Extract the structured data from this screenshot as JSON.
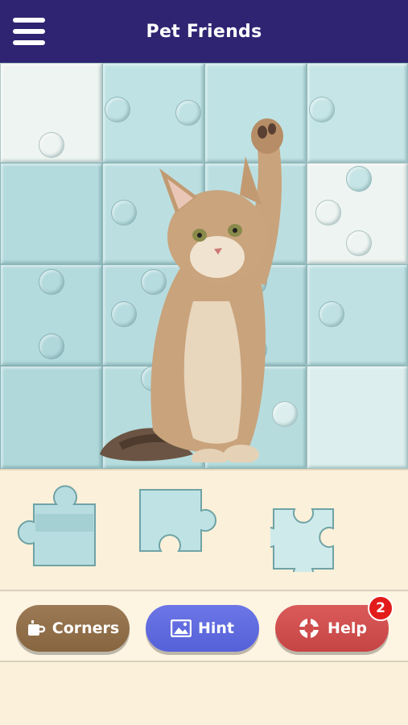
{
  "header": {
    "title": "Pet Friends",
    "menu_icon": "hamburger-menu-icon"
  },
  "board": {
    "columns": 4,
    "rows": 4,
    "image_subject": "kitten"
  },
  "tray": {
    "pieces": [
      {
        "id": "piece-1"
      },
      {
        "id": "piece-2"
      },
      {
        "id": "piece-3"
      }
    ]
  },
  "buttons": {
    "corners": {
      "label": "Corners",
      "icon": "mug-icon",
      "color": "#8f6e4a"
    },
    "hint": {
      "label": "Hint",
      "icon": "image-icon",
      "color": "#5e69df"
    },
    "help": {
      "label": "Help",
      "icon": "lifebuoy-icon",
      "color": "#cf4d4d",
      "badge": "2"
    }
  },
  "colors": {
    "header": "#2f2472",
    "tray": "#fbf0d9",
    "board_tile": "#b9dfe2"
  }
}
